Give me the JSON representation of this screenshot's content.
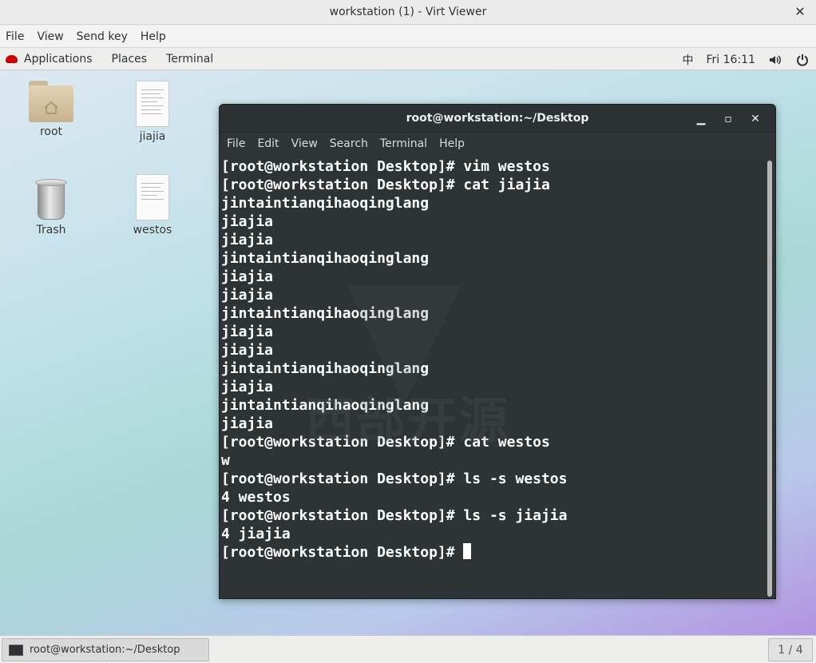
{
  "viewer": {
    "title": "workstation (1) - Virt Viewer",
    "menu": [
      "File",
      "View",
      "Send key",
      "Help"
    ]
  },
  "topbar": {
    "applications": "Applications",
    "places": "Places",
    "terminal": "Terminal",
    "input_method": "中",
    "clock": "Fri 16:11"
  },
  "desktop_icons": {
    "root": "root",
    "jiajia": "jiajia",
    "trash": "Trash",
    "westos": "westos"
  },
  "terminal": {
    "title": "root@workstation:~/Desktop",
    "menu": [
      "File",
      "Edit",
      "View",
      "Search",
      "Terminal",
      "Help"
    ],
    "lines": [
      "[root@workstation Desktop]# vim westos",
      "[root@workstation Desktop]# cat jiajia",
      "jintaintianqihaoqinglang",
      "jiajia",
      "jiajia",
      "jintaintianqihaoqinglang",
      "jiajia",
      "jiajia",
      "jintaintianqihaoqinglang",
      "jiajia",
      "jiajia",
      "jintaintianqihaoqinglang",
      "jiajia",
      "jintaintianqihaoqinglang",
      "jiajia",
      "[root@workstation Desktop]# cat westos",
      "w",
      "[root@workstation Desktop]# ls -s westos",
      "4 westos",
      "[root@workstation Desktop]# ls -s jiajia",
      "4 jiajia"
    ],
    "prompt": "[root@workstation Desktop]# "
  },
  "watermark": "西部开源",
  "taskbar": {
    "window_label": "root@workstation:~/Desktop",
    "workspace": "1 / 4"
  }
}
